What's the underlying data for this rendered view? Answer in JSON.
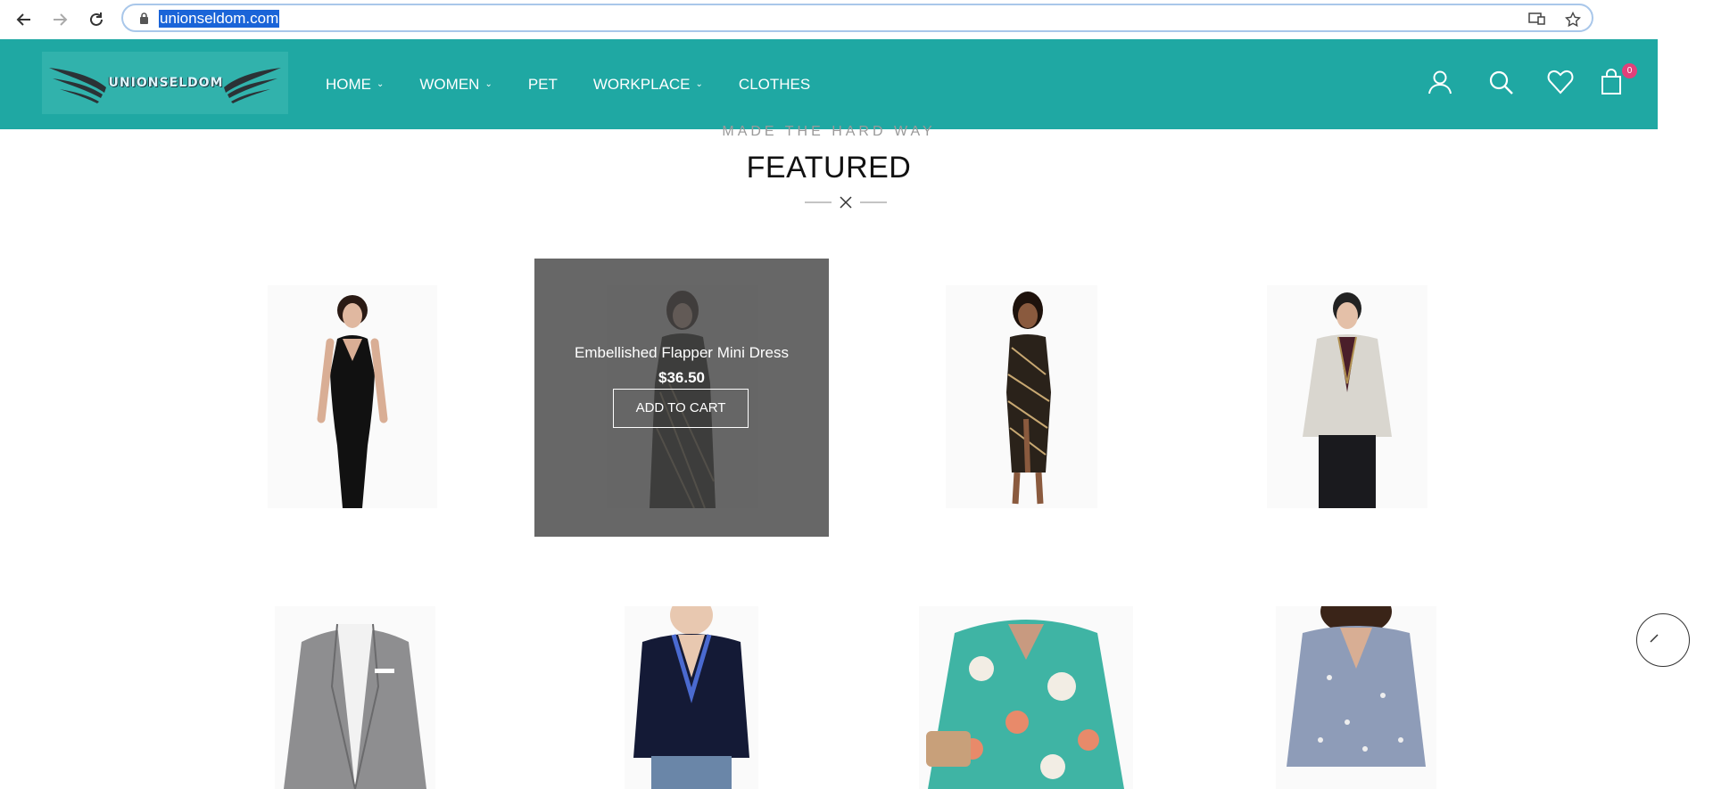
{
  "browser": {
    "url": "unionseldom.com"
  },
  "header": {
    "logo_text": "UNIONSELDOM",
    "menu": [
      {
        "label": "HOME",
        "has_dropdown": true
      },
      {
        "label": "WOMEN",
        "has_dropdown": true
      },
      {
        "label": "PET",
        "has_dropdown": false
      },
      {
        "label": "WORKPLACE",
        "has_dropdown": true
      },
      {
        "label": "CLOTHES",
        "has_dropdown": false
      }
    ],
    "cart_count": "0",
    "icons": [
      "user-icon",
      "search-icon",
      "heart-icon",
      "shopping-bag-icon"
    ],
    "brand_color": "#1fa8a3",
    "badge_color": "#e2407a"
  },
  "section": {
    "kicker": "MADE THE HARD WAY",
    "title": "FEATURED"
  },
  "hovered_product": {
    "name": "Embellished Flapper Mini Dress",
    "price": "$36.50",
    "cta": "ADD TO CART"
  },
  "products": [
    {
      "image": "black-bodycon-dress"
    },
    {
      "image": "embellished-flapper-mini-dress"
    },
    {
      "image": "gold-sequin-midi-dress"
    },
    {
      "image": "men-cream-blazer"
    },
    {
      "image": "grey-men-blazer"
    },
    {
      "image": "navy-embroidered-tunic"
    },
    {
      "image": "teal-floral-blouse"
    },
    {
      "image": "blue-floral-blouse"
    }
  ]
}
